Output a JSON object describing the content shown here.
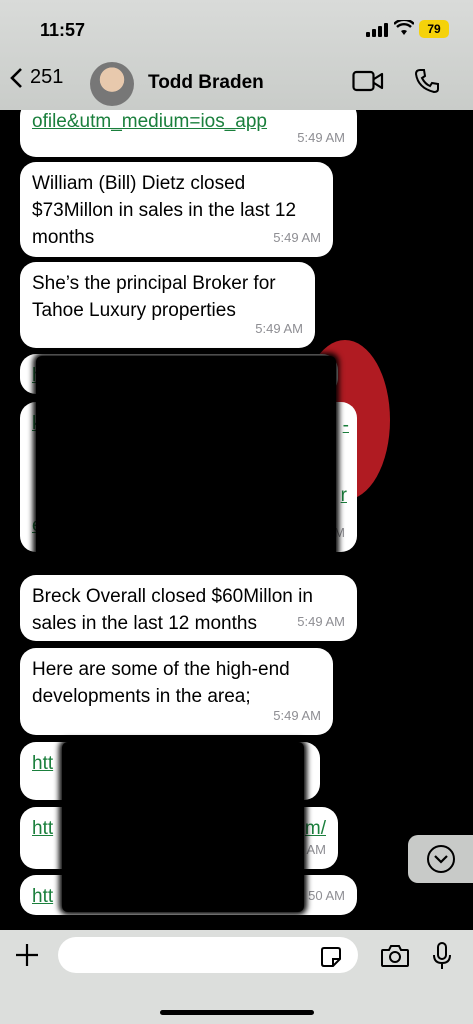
{
  "status": {
    "time": "11:57",
    "battery": "79"
  },
  "header": {
    "back_count": "251",
    "contact_name": "Todd Braden"
  },
  "messages": [
    {
      "text": "ofile&utm_medium=ios_app",
      "time": "5:49 AM"
    },
    {
      "text": "William (Bill) Dietz closed $73Millon in sales in the last 12 months",
      "time": "5:49 AM"
    },
    {
      "text": "She’s the principal Broker for Tahoe Luxury properties",
      "time": "5:49 AM"
    },
    {
      "text": "Breck Overall closed $60Millon in sales in the last 12 months",
      "time": "5:49 AM"
    },
    {
      "text": "Here are some of the high-end developments in the area;",
      "time": "5:49 AM"
    },
    {
      "text": "htt",
      "time": ""
    },
    {
      "text": "htt",
      "tail": "m/",
      "time": "AM"
    },
    {
      "text": "htt",
      "time": "50 AM"
    }
  ],
  "partial_links": {
    "left_a": "h",
    "left_b": "k",
    "right_b": "-",
    "fragment_r": "r",
    "fragment_e": "e",
    "time_m": "M"
  },
  "input": {
    "placeholder": ""
  },
  "icons": [
    "chevron-left-icon",
    "video-icon",
    "phone-icon",
    "plus-icon",
    "sticker-icon",
    "camera-icon",
    "microphone-icon",
    "chevron-down-icon"
  ]
}
